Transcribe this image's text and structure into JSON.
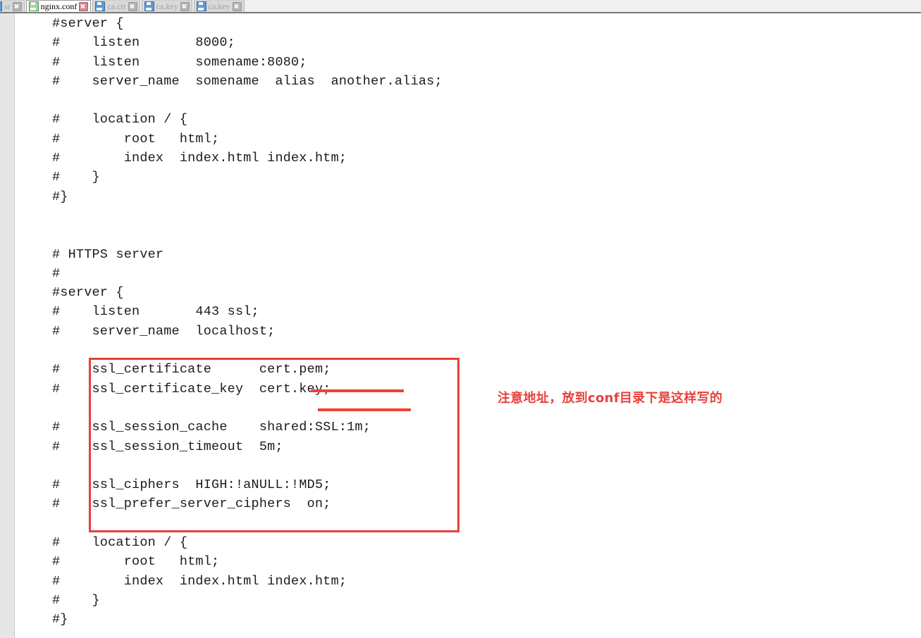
{
  "window": {
    "title": "nginx.conf",
    "app_kind": "text-editor"
  },
  "tabbar": {
    "tabs": [
      {
        "label": "sr",
        "state": "inactive",
        "icon": "disk-icon-blue",
        "close_icon": "close-icon-gray",
        "clipped": true
      },
      {
        "label": "nginx.conf",
        "state": "active",
        "icon": "disk-icon-green",
        "close_icon": "close-icon-red",
        "clipped": false
      },
      {
        "label": "ca.crt",
        "state": "inactive",
        "icon": "disk-icon-blue",
        "close_icon": "close-icon-gray",
        "clipped": false
      },
      {
        "label": "ca.key",
        "state": "inactive",
        "icon": "disk-icon-blue",
        "close_icon": "close-icon-gray",
        "clipped": false
      },
      {
        "label": "ca.key",
        "state": "inactive",
        "icon": "disk-icon-blue",
        "close_icon": "close-icon-gray",
        "clipped": false
      }
    ]
  },
  "editor": {
    "language": "nginx-conf",
    "code": "#server {\n#    listen       8000;\n#    listen       somename:8080;\n#    server_name  somename  alias  another.alias;\n\n#    location / {\n#        root   html;\n#        index  index.html index.htm;\n#    }\n#}\n\n\n# HTTPS server\n#\n#server {\n#    listen       443 ssl;\n#    server_name  localhost;\n\n#    ssl_certificate      cert.pem;\n#    ssl_certificate_key  cert.key;\n\n#    ssl_session_cache    shared:SSL:1m;\n#    ssl_session_timeout  5m;\n\n#    ssl_ciphers  HIGH:!aNULL:!MD5;\n#    ssl_prefer_server_ciphers  on;\n\n#    location / {\n#        root   html;\n#        index  index.html index.htm;\n#    }\n#}"
  },
  "annotations": {
    "box_color": "#e8403a",
    "underline_color": "#ef4136",
    "note_color": "#e8413b",
    "note_text": "注意地址，放到conf目录下是这样写的",
    "underlined_values": [
      "cert.pem;",
      "cert.key;"
    ],
    "highlighted_directives": [
      "ssl_certificate",
      "ssl_certificate_key",
      "ssl_session_cache",
      "ssl_session_timeout",
      "ssl_ciphers",
      "ssl_prefer_server_ciphers"
    ]
  }
}
